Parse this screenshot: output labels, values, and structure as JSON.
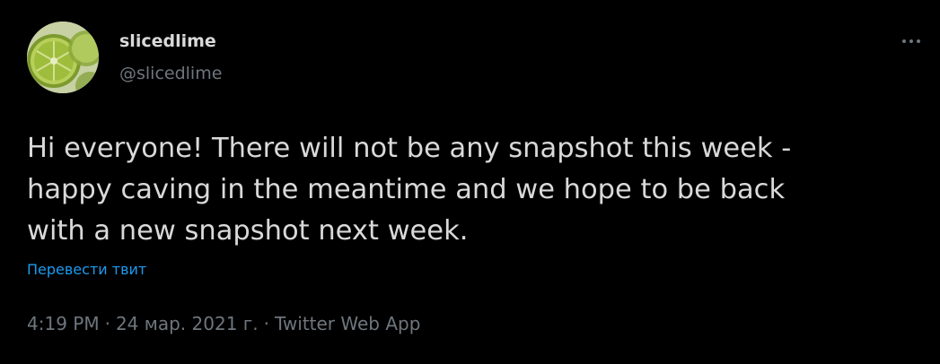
{
  "tweet": {
    "author": {
      "display_name": "slicedlime",
      "handle": "@slicedlime",
      "avatar_icon": "lime-slice-avatar"
    },
    "more_icon": "more-options-icon",
    "text": "Hi everyone! There will not be any snapshot this week -\nhappy caving in the meantime and we hope to be back\nwith a new snapshot next week.",
    "translate_label": "Перевести твит",
    "time": "4:19 PM",
    "separator": "·",
    "date": "24 мар. 2021 г.",
    "source": "Twitter Web App"
  },
  "colors": {
    "background": "#000000",
    "text": "#d9d9d9",
    "muted": "#6e767d",
    "link": "#1d9bf0"
  }
}
